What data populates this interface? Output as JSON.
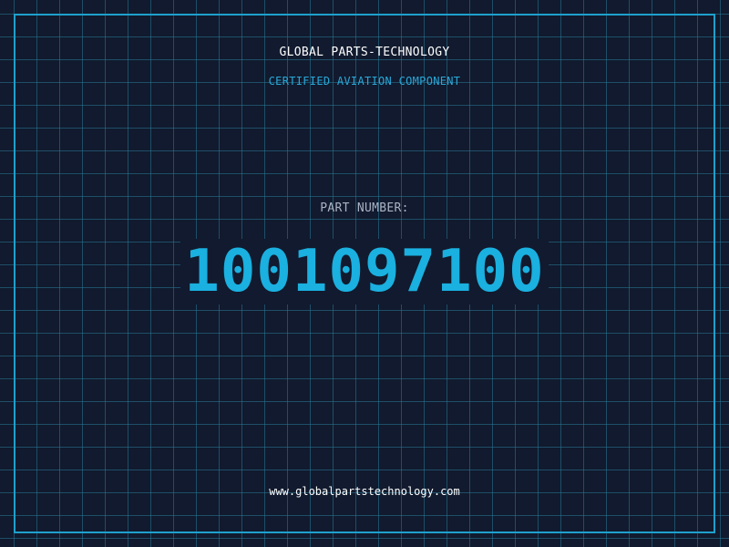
{
  "header": {
    "company": "GLOBAL PARTS-TECHNOLOGY",
    "tagline": "CERTIFIED AVIATION COMPONENT"
  },
  "part": {
    "label": "PART NUMBER:",
    "number": "1001097100"
  },
  "footer": {
    "url": "www.globalpartstechnology.com"
  },
  "colors": {
    "background": "#111a2e",
    "grid": "#28789a",
    "frame": "#1ea0cc",
    "accent": "#1ab0e0",
    "text": "#ffffff",
    "muted": "#aab4c4"
  }
}
